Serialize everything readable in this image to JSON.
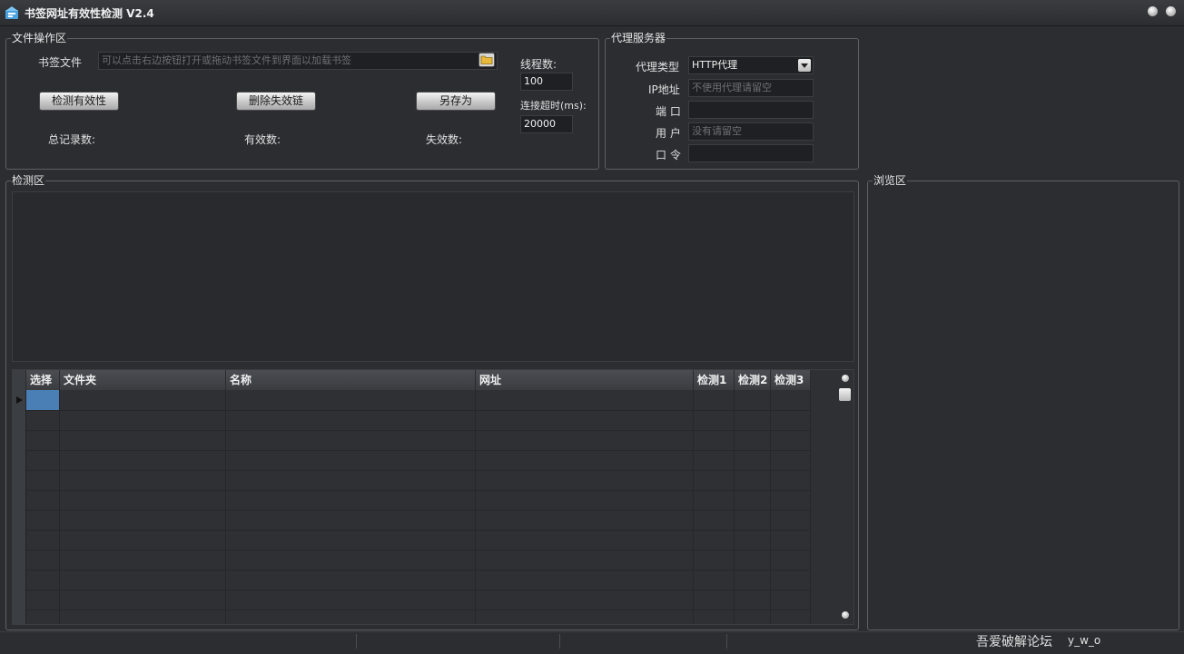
{
  "window": {
    "title": "书签网址有效性检测 V2.4"
  },
  "file_ops": {
    "group_title": "文件操作区",
    "bookmark_label": "书签文件",
    "bookmark_placeholder": "可以点击右边按钮打开或拖动书签文件到界面以加载书签",
    "check_button": "检测有效性",
    "delete_button": "删除失效链",
    "save_as_button": "另存为",
    "total_label": "总记录数:",
    "valid_label": "有效数:",
    "invalid_label": "失效数:",
    "threads_label": "线程数:",
    "threads_value": "100",
    "timeout_label": "连接超时(ms):",
    "timeout_value": "20000"
  },
  "proxy": {
    "group_title": "代理服务器",
    "type_label": "代理类型",
    "type_value": "HTTP代理",
    "ip_label": "IP地址",
    "ip_placeholder": "不使用代理请留空",
    "port_label": "端 口",
    "port_value": "",
    "user_label": "用 户",
    "user_placeholder": "没有请留空",
    "password_label": "口 令",
    "password_value": ""
  },
  "detect": {
    "group_title": "检测区",
    "columns": [
      "选择",
      "文件夹",
      "名称",
      "网址",
      "检测1",
      "检测2",
      "检测3"
    ],
    "row_count": 12
  },
  "browse": {
    "group_title": "浏览区"
  },
  "status": {
    "forum": "吾爱破解论坛",
    "author": "y_w_o"
  },
  "colors": {
    "background": "#2b2d30",
    "border": "#5d6066",
    "selected_cell": "#4a7fb5"
  }
}
